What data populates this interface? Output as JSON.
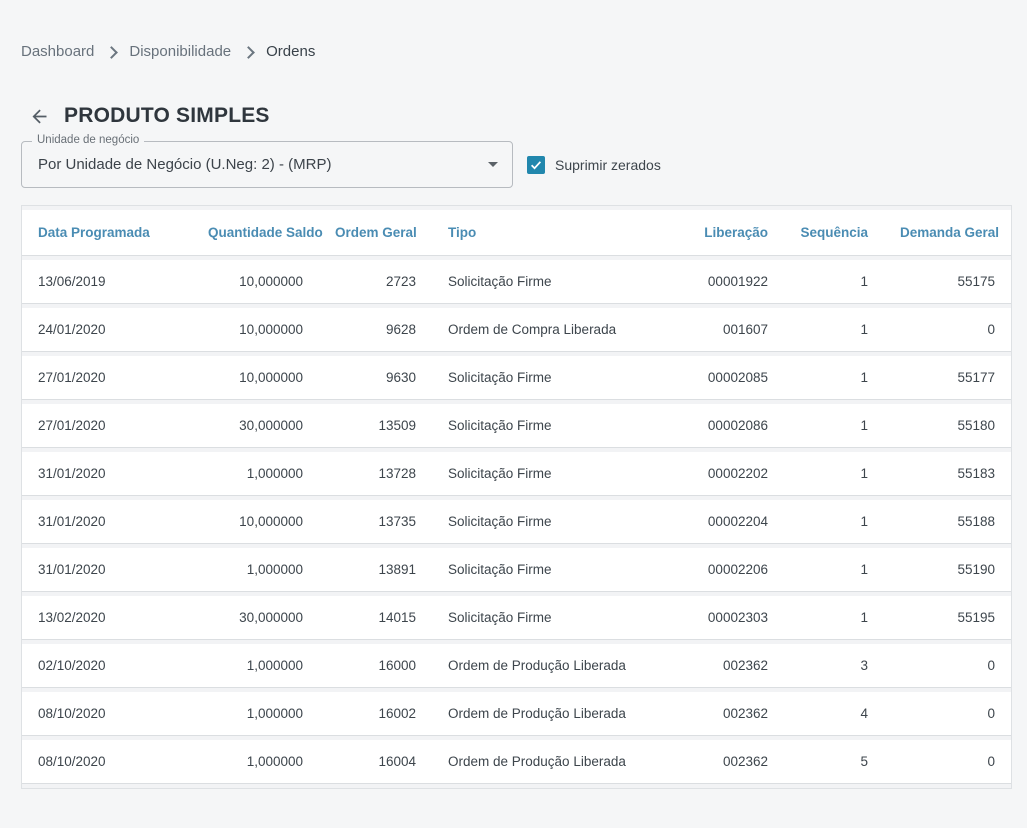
{
  "breadcrumb": {
    "items": [
      {
        "label": "Dashboard",
        "active": false
      },
      {
        "label": "Disponibilidade",
        "active": false
      },
      {
        "label": "Ordens",
        "active": true
      }
    ]
  },
  "page": {
    "title": "PRODUTO SIMPLES"
  },
  "filter": {
    "select_label": "Unidade de negócio",
    "select_value": "Por Unidade de Negócio (U.Neg: 2) - (MRP)",
    "checkbox_label": "Suprimir zerados",
    "checkbox_checked": true
  },
  "colors": {
    "header_blue": "#4a8cb3",
    "checkbox_blue": "#2187ad",
    "page_background": "#f5f6f7"
  },
  "table": {
    "columns": [
      "Data Programada",
      "Quantidade Saldo",
      "Ordem Geral",
      "Tipo",
      "Liberação",
      "Sequência",
      "Demanda Geral"
    ],
    "rows": [
      [
        "13/06/2019",
        "10,000000",
        "2723",
        "Solicitação Firme",
        "00001922",
        "1",
        "55175"
      ],
      [
        "24/01/2020",
        "10,000000",
        "9628",
        "Ordem de Compra Liberada",
        "001607",
        "1",
        "0"
      ],
      [
        "27/01/2020",
        "10,000000",
        "9630",
        "Solicitação Firme",
        "00002085",
        "1",
        "55177"
      ],
      [
        "27/01/2020",
        "30,000000",
        "13509",
        "Solicitação Firme",
        "00002086",
        "1",
        "55180"
      ],
      [
        "31/01/2020",
        "1,000000",
        "13728",
        "Solicitação Firme",
        "00002202",
        "1",
        "55183"
      ],
      [
        "31/01/2020",
        "10,000000",
        "13735",
        "Solicitação Firme",
        "00002204",
        "1",
        "55188"
      ],
      [
        "31/01/2020",
        "1,000000",
        "13891",
        "Solicitação Firme",
        "00002206",
        "1",
        "55190"
      ],
      [
        "13/02/2020",
        "30,000000",
        "14015",
        "Solicitação Firme",
        "00002303",
        "1",
        "55195"
      ],
      [
        "02/10/2020",
        "1,000000",
        "16000",
        "Ordem de Produção Liberada",
        "002362",
        "3",
        "0"
      ],
      [
        "08/10/2020",
        "1,000000",
        "16002",
        "Ordem de Produção Liberada",
        "002362",
        "4",
        "0"
      ],
      [
        "08/10/2020",
        "1,000000",
        "16004",
        "Ordem de Produção Liberada",
        "002362",
        "5",
        "0"
      ]
    ]
  }
}
